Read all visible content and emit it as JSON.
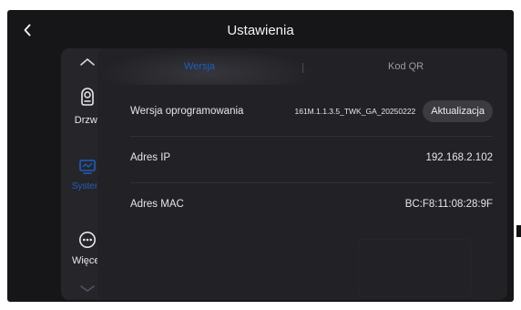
{
  "header": {
    "title": "Ustawienia"
  },
  "sidebar": {
    "items": [
      {
        "label": "Drzwi",
        "icon": "doorbell-icon"
      },
      {
        "label": "System",
        "icon": "monitor-icon"
      },
      {
        "label": "Więcej",
        "icon": "more-icon"
      }
    ]
  },
  "tabs": [
    {
      "label": "Wersja"
    },
    {
      "label": "Kod QR"
    }
  ],
  "rows": [
    {
      "label": "Wersja oprogramowania",
      "value": "161M.1.1.3.5_TWK_GA_20250222",
      "button": "Aktualizacja"
    },
    {
      "label": "Adres IP",
      "value": "192.168.2.102"
    },
    {
      "label": "Adres MAC",
      "value": "BC:F8:11:08:28:9F"
    }
  ],
  "colors": {
    "accent": "#1f5fbf",
    "background": "#161619",
    "sidebar": "#26262a",
    "panel": "#222226"
  }
}
